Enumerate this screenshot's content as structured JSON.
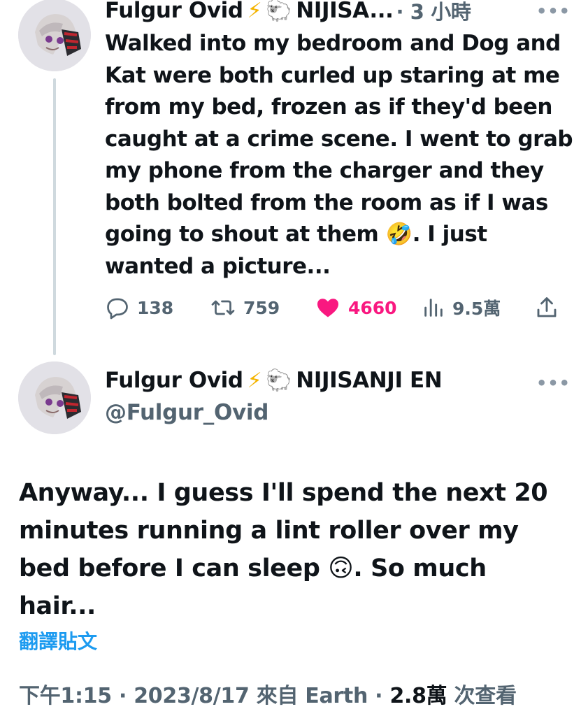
{
  "reply_tweet": {
    "author_name": "Fulgur Ovid",
    "bolt_emoji": "⚡",
    "sheep_emoji": "🐑",
    "affiliation_truncated": "NIJISA...",
    "time_ago": "· 3 小時",
    "text_before_emoji": "Walked into my bedroom and Dog and Kat were both curled up staring at me from my bed, frozen as if they'd been caught at a crime scene. I went to grab my phone from the charger and they both bolted from the room as if I was going to shout at them ",
    "inline_emoji": "🤣",
    "text_after_emoji": ". I just wanted a picture...",
    "more": "•••",
    "actions": {
      "replies": "138",
      "retweets": "759",
      "likes": "4660",
      "views": "9.5萬"
    },
    "icons": [
      "reply-icon",
      "retweet-icon",
      "heart-icon",
      "views-icon",
      "share-icon"
    ],
    "like_color": "#f91880"
  },
  "main_tweet": {
    "author_name": "Fulgur Ovid",
    "bolt_emoji": "⚡",
    "sheep_emoji": "🐑",
    "affiliation": "NIJISANJI EN",
    "handle": "@Fulgur_Ovid",
    "more": "•••",
    "text_before_emoji": "Anyway... I guess I'll spend the next 20 minutes running a lint roller over my bed before I can sleep ",
    "inline_emoji": "🙃",
    "text_after_emoji": ". So much hair...",
    "translate_link": "翻譯貼文",
    "meta": {
      "time": "下午1:15",
      "date": "· 2023/8/17",
      "source_prefix": "來自",
      "source": "Earth",
      "sep": "·",
      "views_count": "2.8萬",
      "views_label": "次查看"
    },
    "link_color": "#1d9bf0"
  }
}
